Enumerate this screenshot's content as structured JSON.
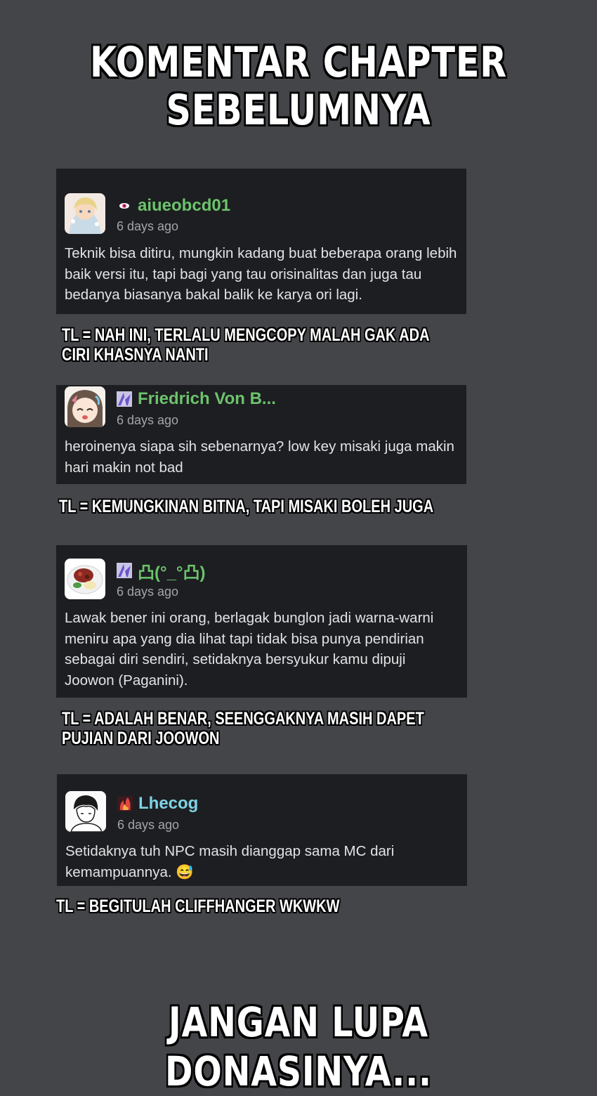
{
  "header": {
    "line1": "KOMENTAR CHAPTER",
    "line2": "SEBELUMNYA"
  },
  "comments": [
    {
      "username": "aiueobcd01",
      "username_color": "#6cc36c",
      "badge_icon": "pink-eye-badge-icon",
      "avatar": "anime-girl-avatar",
      "time": "6 days ago",
      "text": "Teknik bisa ditiru, mungkin kadang buat beberapa orang lebih baik versi itu, tapi bagi yang tau orisinalitas dan juga tau bedanya biasanya bakal balik ke karya ori lagi.",
      "tl_note": "TL = NAH INI, TERLALU MENGCOPY MALAH GAK ADA CIRI KHASNYA NANTI"
    },
    {
      "username": "Friedrich Von B...",
      "username_color": "#6cc36c",
      "badge_icon": "purple-crystal-badge-icon",
      "avatar": "crying-anime-avatar",
      "time": "6 days ago",
      "text": "heroinenya siapa sih sebenarnya? low key misaki juga makin hari makin not bad",
      "tl_note": "TL = KEMUNGKINAN BITNA, TAPI MISAKI BOLEH JUGA"
    },
    {
      "username": "凸(°_°凸)",
      "username_color": "#6cc36c",
      "badge_icon": "purple-crystal-badge-icon",
      "avatar": "food-plate-avatar",
      "time": "6 days ago",
      "text": "Lawak bener ini orang, berlagak bunglon jadi warna-warni meniru apa yang dia lihat tapi tidak bisa punya pendirian sebagai diri sendiri, setidaknya bersyukur kamu dipuji Joowon (Paganini).",
      "tl_note": "TL = ADALAH BENAR, SEENGGAKNYA MASIH DAPET PUJIAN DARI JOOWON"
    },
    {
      "username": "Lhecog",
      "username_color": "#7fd3e6",
      "badge_icon": "red-flame-badge-icon",
      "avatar": "manga-boy-avatar",
      "time": "6 days ago",
      "text": "Setidaknya tuh NPC masih dianggap sama MC dari kemampuannya. 😅",
      "tl_note": "TL = BEGITULAH CLIFFHANGER WKWKW"
    }
  ],
  "footer": {
    "text": "JANGAN LUPA DONASINYA..."
  }
}
